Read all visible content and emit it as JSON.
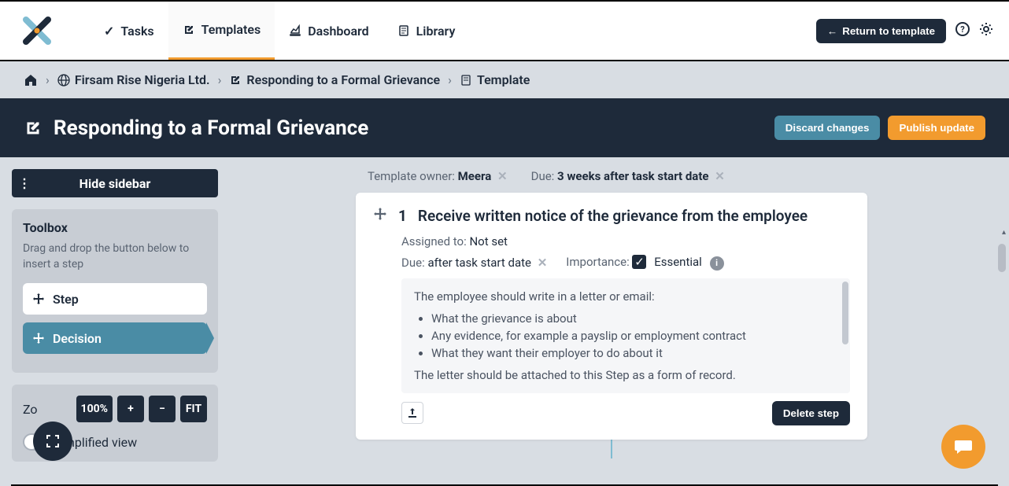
{
  "nav": {
    "tasks": "Tasks",
    "templates": "Templates",
    "dashboard": "Dashboard",
    "library": "Library",
    "return_btn": "Return to template"
  },
  "breadcrumb": {
    "org": "Firsam Rise Nigeria Ltd.",
    "template": "Responding to a Formal Grievance",
    "page": "Template"
  },
  "title": "Responding to a Formal Grievance",
  "title_actions": {
    "discard": "Discard changes",
    "publish": "Publish update"
  },
  "sidebar": {
    "hide": "Hide sidebar",
    "toolbox_title": "Toolbox",
    "toolbox_desc": "Drag and drop the button below to insert a step",
    "step_btn": "Step",
    "decision_btn": "Decision",
    "zoom_label_prefix": "Zo",
    "zoom_pct": "100%",
    "zoom_plus": "+",
    "zoom_minus": "−",
    "zoom_fit": "FIT",
    "simplified": "implified view"
  },
  "meta": {
    "owner_label": "Template owner:",
    "owner": "Meera",
    "due_label": "Due:",
    "due": "3 weeks after task start date"
  },
  "step": {
    "num": "1",
    "title": "Receive written notice of the grievance from the employee",
    "assigned_label": "Assigned to:",
    "assigned": "Not set",
    "due_label": "Due:",
    "due": "after task start date",
    "importance_label": "Importance:",
    "importance": "Essential",
    "body_intro": "The employee should write in a letter or email:",
    "bullets": [
      "What the grievance is about",
      "Any evidence, for example a payslip or employment contract",
      "What they want their employer to do about it"
    ],
    "body_outro": "The letter should be attached to this Step as a form of record.",
    "delete": "Delete step"
  }
}
